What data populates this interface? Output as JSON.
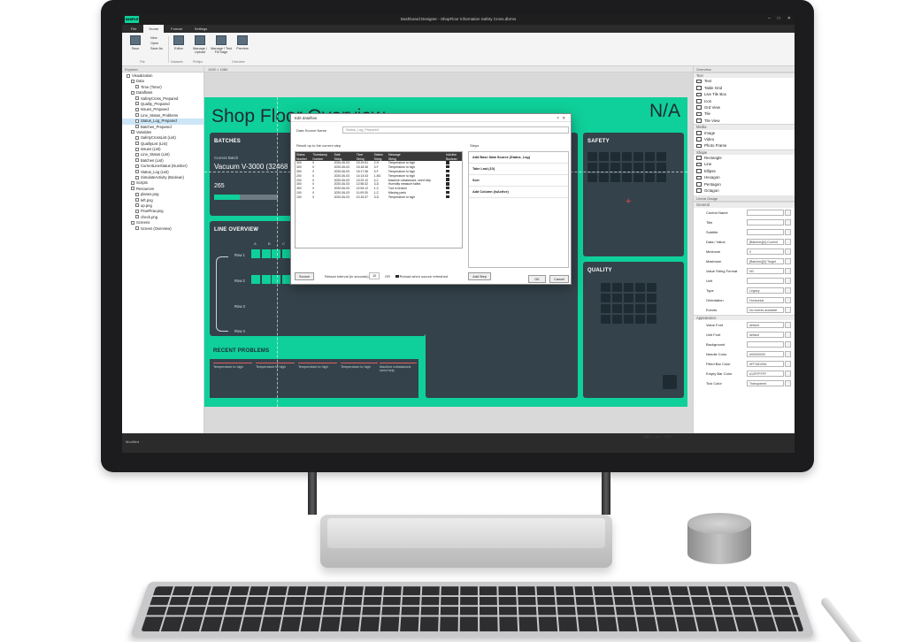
{
  "window": {
    "title": "Dashboard Designer - ShopFloor Information Safety Cross.dbrms",
    "controls": [
      "–",
      "□",
      "✕"
    ],
    "logo": "SAMPLE"
  },
  "menu": [
    "File",
    "Home",
    "Format",
    "Settings"
  ],
  "ribbon": {
    "buttons": [
      {
        "label": "Save",
        "icon": "save-icon"
      },
      {
        "label": "Editor",
        "icon": "editor-icon"
      },
      {
        "label": "Manage / Upload",
        "icon": "manage-upload-icon"
      },
      {
        "label": "Manage / Test Fill Sage",
        "icon": "manage-test-icon"
      },
      {
        "label": "Preview",
        "icon": "preview-icon"
      }
    ],
    "small_buttons": [
      "New",
      "Open",
      "Save As"
    ],
    "groups": [
      "File",
      "Datasets",
      "Phillips",
      "Overview"
    ]
  },
  "left_panel": {
    "header": "Explorer",
    "tree": [
      {
        "label": "Visualization",
        "indent": 1
      },
      {
        "label": "Data",
        "indent": 2
      },
      {
        "label": "Time (Timer)",
        "indent": 3
      },
      {
        "label": "Dataflows",
        "indent": 2
      },
      {
        "label": "SafetyCross_Prepared",
        "indent": 3
      },
      {
        "label": "Quality_Prepared",
        "indent": 3
      },
      {
        "label": "Issues_Prepared",
        "indent": 3
      },
      {
        "label": "Line_Status_Problems",
        "indent": 3
      },
      {
        "label": "Status_Log_Prepared",
        "indent": 3,
        "selected": true
      },
      {
        "label": "Batches_Prepared",
        "indent": 3
      },
      {
        "label": "Variables",
        "indent": 2
      },
      {
        "label": "SafetyCrossList (List)",
        "indent": 3
      },
      {
        "label": "QualityList (List)",
        "indent": 3
      },
      {
        "label": "Issues (List)",
        "indent": 3
      },
      {
        "label": "Line_Status (List)",
        "indent": 3
      },
      {
        "label": "Batches (List)",
        "indent": 3
      },
      {
        "label": "CurrentLineStatus (Number)",
        "indent": 3
      },
      {
        "label": "Status_Log (List)",
        "indent": 3
      },
      {
        "label": "SimulateActivity (Boolean)",
        "indent": 3
      },
      {
        "label": "Scripts",
        "indent": 2
      },
      {
        "label": "Resources",
        "indent": 2
      },
      {
        "label": "planes.png",
        "indent": 3
      },
      {
        "label": "left.png",
        "indent": 3
      },
      {
        "label": "up.png",
        "indent": 3
      },
      {
        "label": "FlowFlow.png",
        "indent": 3
      },
      {
        "label": "check.png",
        "indent": 3
      },
      {
        "label": "Screens",
        "indent": 2
      },
      {
        "label": "Screen (Overview)",
        "indent": 3
      }
    ]
  },
  "canvas": {
    "header": "1920 × 1080",
    "dashboard": {
      "title": "Shop Floor Overview",
      "na": "N/A",
      "batches": {
        "heading": "BATCHES",
        "current_label": "Current Batch",
        "current_value": "Vacuum V-3000 (32468",
        "count": "265",
        "progress": 0.4
      },
      "line_overview": {
        "heading": "LINE OVERVIEW",
        "columns": [
          "A",
          "B",
          "C"
        ],
        "rows": [
          "Row 1",
          "Row 2",
          "Row 3",
          "Row 4"
        ]
      },
      "recent_problems": {
        "heading": "RECENT PROBLEMS",
        "items": [
          "Temperature to high",
          "Temperature to high",
          "Temperature to high",
          "Temperature to high",
          "Machine unbalanced, need help"
        ]
      },
      "safety": {
        "heading": "SAFETY"
      },
      "quality": {
        "heading": "QUALITY"
      }
    }
  },
  "dialog": {
    "title": "Edit dataflow",
    "name_label": "Data Source Name",
    "name_value": "Status_Log_Prepared",
    "result_label": "Result up to the current step",
    "steps_label": "Steps",
    "columns": [
      {
        "name": "Status",
        "type": "Number"
      },
      {
        "name": "Timestamp",
        "type": "Number"
      },
      {
        "name": "Date",
        "type": "String"
      },
      {
        "name": "Time",
        "type": "String"
      },
      {
        "name": "Station",
        "type": "String"
      },
      {
        "name": "Message",
        "type": "String"
      },
      {
        "name": "IsActive",
        "type": "Boolean"
      }
    ],
    "rows": [
      [
        "300",
        "0",
        "2020-06-03",
        "15:19:51",
        "2-H",
        "Temperature to high"
      ],
      [
        "300",
        "0",
        "2020-06-03",
        "15:18:36",
        "3-F",
        "Temperature to high"
      ],
      [
        "300",
        "0",
        "2020-06-03",
        "15:17:36",
        "3-F",
        "Temperature to high"
      ],
      [
        "200",
        "0",
        "2020-06-03",
        "14:13:43",
        "1-M1",
        "Temperature to high"
      ],
      [
        "200",
        "0",
        "2020-06-03",
        "13:22:12",
        "4-2",
        "Machine unbalanced, need help"
      ],
      [
        "300",
        "0",
        "2020-06-03",
        "12:56:32",
        "3-D",
        "Humidity measure failed"
      ],
      [
        "300",
        "0",
        "2020-06-03",
        "12:54:12",
        "1-C",
        "Tool is broken"
      ],
      [
        "100",
        "0",
        "2020-06-03",
        "11:09:30",
        "1-C",
        "Missing parts"
      ],
      [
        "100",
        "0",
        "2020-06-03",
        "10:15:37",
        "3-D",
        "Temperature to high"
      ]
    ],
    "steps": [
      "Add Base Data Source (Status_Log)",
      "Take Last (10)",
      "Sort",
      "Add Column (isActive)"
    ],
    "source_btn": "Source",
    "reload_label": "Reload interval (in seconds)",
    "reload_value": "10",
    "or": "OR",
    "reload_check": "Reload when source refreshed",
    "add_step": "Add Step",
    "ok": "OK",
    "cancel": "Cancel"
  },
  "right_panel": {
    "header": "Overview",
    "sections": [
      {
        "name": "Text",
        "items": [
          "Text",
          "Table Grid",
          "Live Tile Box",
          "Icon",
          "Grd View",
          "Tile",
          "Tile View"
        ]
      },
      {
        "name": "Media",
        "items": [
          "Image",
          "Video",
          "Photo Frame"
        ]
      },
      {
        "name": "Shape",
        "items": [
          "Rectangle",
          "Line",
          "Ellipse",
          "Hexagon",
          "Pentagon",
          "Octagon"
        ]
      }
    ],
    "props_header": "Linear Gauge",
    "props_group": "General",
    "props": [
      {
        "label": "Control Name",
        "value": ""
      },
      {
        "label": "Title",
        "value": ""
      },
      {
        "label": "Subtitle",
        "value": ""
      },
      {
        "label": "Data / Value",
        "value": "[Batches][0].Current"
      },
      {
        "label": "Minimum",
        "value": "0"
      },
      {
        "label": "Maximum",
        "value": "[Batches][0].Target"
      },
      {
        "label": "Value String Format",
        "value": "N0"
      },
      {
        "label": "Unit",
        "value": ""
      },
      {
        "label": "Type",
        "value": "Legacy"
      },
      {
        "label": "Orientation",
        "value": "Horizontal"
      },
      {
        "label": "Events",
        "value": "No events available"
      }
    ],
    "appearance_group": "Appearance",
    "appearance": [
      {
        "label": "Value Font",
        "value": "default"
      },
      {
        "label": "Unit Font",
        "value": "default"
      },
      {
        "label": "Background",
        "value": ""
      },
      {
        "label": "Needle Color",
        "value": "#00000000"
      },
      {
        "label": "Filled Bar Color",
        "value": "#FF16D09A"
      },
      {
        "label": "Empty Bar Color",
        "value": "#12FFFFFF"
      },
      {
        "label": "Tick Color",
        "value": "Transparent"
      }
    ]
  },
  "status": {
    "text": "Modified",
    "zoom": "65%",
    "fit": "10%"
  },
  "colors": {
    "accent": "#0fd09a",
    "tile": "#34424b",
    "cell": "#1f2b33"
  }
}
